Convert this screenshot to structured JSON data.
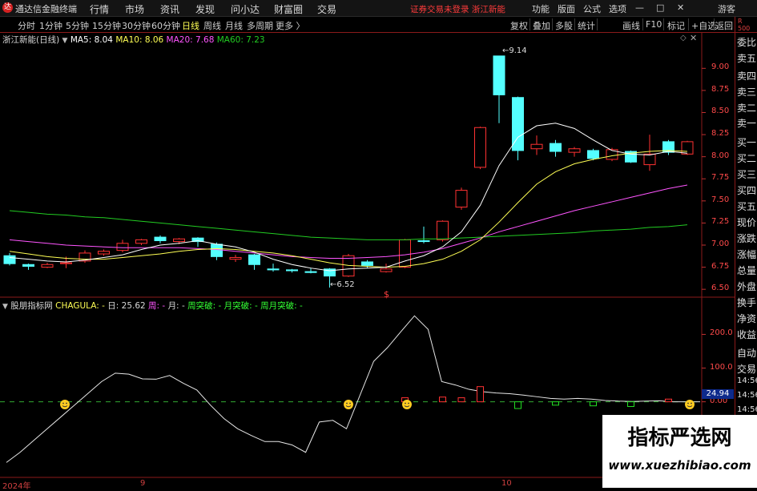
{
  "app": {
    "logo": "达",
    "title": "通达信金融终端"
  },
  "menu": [
    "行情",
    "市场",
    "资讯",
    "发现",
    "问小达",
    "财富圈",
    "交易"
  ],
  "notice": "证券交易未登录  浙江新能",
  "top_right": [
    "功能",
    "版面",
    "公式",
    "选项"
  ],
  "window": {
    "min": "—",
    "max": "□",
    "close": "✕",
    "guest": "游客"
  },
  "periods": [
    {
      "label": "分时",
      "active": false
    },
    {
      "label": "1分钟",
      "active": false
    },
    {
      "label": "5分钟",
      "active": false
    },
    {
      "label": "15分钟",
      "active": false
    },
    {
      "label": "30分钟",
      "active": false
    },
    {
      "label": "60分钟",
      "active": false
    },
    {
      "label": "日线",
      "active": true
    },
    {
      "label": "周线",
      "active": false
    },
    {
      "label": "月线",
      "active": false
    },
    {
      "label": "多周期",
      "active": false
    },
    {
      "label": "更多 〉",
      "active": false
    }
  ],
  "tools": [
    "复权",
    "叠加",
    "多股",
    "统计",
    "画线",
    "F10",
    "标记",
    "+自选",
    "返回"
  ],
  "main_legend": {
    "title": "浙江新能(日线)",
    "ma5": "MA5: 8.04",
    "ma10": "MA10: 8.06",
    "ma20": "MA20: 7.68",
    "ma60": "MA60: 7.23"
  },
  "sub_legend": {
    "title": "股朋指标网",
    "chagula": "CHAGULA: -",
    "day": "日: 25.62",
    "week": "周: -",
    "month": "月: -",
    "weekbreak": "周突破: -",
    "monthbreak": "月突破: -",
    "wmbreak": "周月突破: -"
  },
  "right_panel": {
    "top": "R\n500",
    "items": [
      "委比",
      "卖五",
      "卖四",
      "卖三",
      "卖二",
      "卖一",
      "买一",
      "买二",
      "买三",
      "买四",
      "买五",
      "现价",
      "涨跌",
      "涨幅",
      "总量",
      "外盘",
      "换手",
      "净资",
      "收益",
      "自动",
      "交易",
      "14:56",
      "14:56",
      "14:56",
      "14:56",
      "14:56",
      "14:56",
      "14:56",
      "14:56"
    ]
  },
  "watermark": {
    "line1": "指标严选网",
    "line2": "www.xuezhibiao.com"
  },
  "marks": {
    "high": "9.14",
    "low": "6.52",
    "dollar": "$",
    "current_badge": "24.94"
  },
  "colors": {
    "up": "#ff3232",
    "down": "#54ffff",
    "ma5": "#ffffff",
    "ma10": "#ffff55",
    "ma20": "#ff55ff",
    "ma60": "#22cc22",
    "grid": "#8b1a1a"
  },
  "chart_data": [
    {
      "type": "candlestick",
      "title": "浙江新能(日线)",
      "y_ticks": [
        "9.00",
        "8.75",
        "8.50",
        "8.25",
        "8.00",
        "7.75",
        "7.50",
        "7.25",
        "7.00",
        "6.75",
        "6.50"
      ],
      "ylim": [
        6.42,
        9.32
      ],
      "x_labels": [
        "2024年",
        "9",
        "10"
      ],
      "candles": [
        {
          "o": 6.88,
          "c": 6.79,
          "h": 6.91,
          "l": 6.77
        },
        {
          "o": 6.78,
          "c": 6.76,
          "h": 6.79,
          "l": 6.72
        },
        {
          "o": 6.75,
          "c": 6.78,
          "h": 6.8,
          "l": 6.74
        },
        {
          "o": 6.79,
          "c": 6.8,
          "h": 6.87,
          "l": 6.74
        },
        {
          "o": 6.82,
          "c": 6.91,
          "h": 6.94,
          "l": 6.8
        },
        {
          "o": 6.9,
          "c": 6.93,
          "h": 6.95,
          "l": 6.88
        },
        {
          "o": 6.94,
          "c": 7.02,
          "h": 7.06,
          "l": 6.92
        },
        {
          "o": 7.02,
          "c": 7.06,
          "h": 7.07,
          "l": 7.0
        },
        {
          "o": 7.09,
          "c": 7.05,
          "h": 7.11,
          "l": 7.02
        },
        {
          "o": 7.04,
          "c": 7.07,
          "h": 7.08,
          "l": 7.01
        },
        {
          "o": 7.08,
          "c": 7.04,
          "h": 7.09,
          "l": 6.98
        },
        {
          "o": 7.01,
          "c": 6.87,
          "h": 7.03,
          "l": 6.83
        },
        {
          "o": 6.84,
          "c": 6.86,
          "h": 6.89,
          "l": 6.81
        },
        {
          "o": 6.89,
          "c": 6.78,
          "h": 6.9,
          "l": 6.72
        },
        {
          "o": 6.73,
          "c": 6.72,
          "h": 6.79,
          "l": 6.7
        },
        {
          "o": 6.72,
          "c": 6.71,
          "h": 6.73,
          "l": 6.69
        },
        {
          "o": 6.7,
          "c": 6.69,
          "h": 6.74,
          "l": 6.68
        },
        {
          "o": 6.73,
          "c": 6.65,
          "h": 6.74,
          "l": 6.52
        },
        {
          "o": 6.65,
          "c": 6.88,
          "h": 6.9,
          "l": 6.64
        },
        {
          "o": 6.81,
          "c": 6.77,
          "h": 6.83,
          "l": 6.74
        },
        {
          "o": 6.7,
          "c": 6.73,
          "h": 6.79,
          "l": 6.69
        },
        {
          "o": 6.75,
          "c": 7.06,
          "h": 7.07,
          "l": 6.74
        },
        {
          "o": 7.05,
          "c": 7.04,
          "h": 7.21,
          "l": 7.02
        },
        {
          "o": 7.06,
          "c": 7.27,
          "h": 7.28,
          "l": 7.04
        },
        {
          "o": 7.43,
          "c": 7.62,
          "h": 7.65,
          "l": 7.4
        },
        {
          "o": 7.88,
          "c": 8.33,
          "h": 8.34,
          "l": 7.86
        },
        {
          "o": 9.14,
          "c": 8.7,
          "h": 9.14,
          "l": 8.38
        },
        {
          "o": 8.67,
          "c": 8.07,
          "h": 8.68,
          "l": 7.96
        },
        {
          "o": 8.09,
          "c": 8.14,
          "h": 8.24,
          "l": 8.02
        },
        {
          "o": 8.15,
          "c": 8.06,
          "h": 8.19,
          "l": 8.0
        },
        {
          "o": 8.05,
          "c": 8.09,
          "h": 8.11,
          "l": 8.0
        },
        {
          "o": 8.07,
          "c": 7.98,
          "h": 8.09,
          "l": 7.96
        },
        {
          "o": 7.97,
          "c": 8.08,
          "h": 8.1,
          "l": 7.95
        },
        {
          "o": 8.06,
          "c": 7.94,
          "h": 8.07,
          "l": 7.93
        },
        {
          "o": 7.91,
          "c": 8.03,
          "h": 8.25,
          "l": 7.84
        },
        {
          "o": 8.17,
          "c": 8.05,
          "h": 8.19,
          "l": 8.02
        },
        {
          "o": 8.03,
          "c": 8.17,
          "h": 8.18,
          "l": 8.02
        }
      ],
      "ma5": [
        6.86,
        6.84,
        6.82,
        6.81,
        6.83,
        6.86,
        6.89,
        6.95,
        7.0,
        7.02,
        7.05,
        7.01,
        6.98,
        6.92,
        6.84,
        6.78,
        6.74,
        6.71,
        6.73,
        6.74,
        6.75,
        6.82,
        6.88,
        6.98,
        7.15,
        7.45,
        7.9,
        8.22,
        8.35,
        8.38,
        8.32,
        8.19,
        8.07,
        8.03,
        8.02,
        8.06,
        8.04
      ],
      "ma10": [
        6.93,
        6.9,
        6.87,
        6.85,
        6.84,
        6.84,
        6.86,
        6.88,
        6.9,
        6.93,
        6.95,
        6.96,
        6.95,
        6.93,
        6.91,
        6.88,
        6.84,
        6.8,
        6.77,
        6.76,
        6.75,
        6.76,
        6.79,
        6.84,
        6.93,
        7.06,
        7.26,
        7.48,
        7.69,
        7.83,
        7.92,
        7.97,
        8.01,
        8.04,
        8.06,
        8.07,
        8.06
      ],
      "ma20": [
        7.06,
        7.04,
        7.02,
        7.0,
        6.99,
        6.98,
        6.97,
        6.97,
        6.97,
        6.97,
        6.96,
        6.95,
        6.93,
        6.91,
        6.89,
        6.87,
        6.86,
        6.85,
        6.85,
        6.86,
        6.87,
        6.89,
        6.92,
        6.96,
        7.02,
        7.08,
        7.15,
        7.21,
        7.27,
        7.33,
        7.39,
        7.44,
        7.49,
        7.54,
        7.59,
        7.64,
        7.68
      ],
      "ma60": [
        7.39,
        7.37,
        7.35,
        7.34,
        7.32,
        7.31,
        7.29,
        7.27,
        7.25,
        7.23,
        7.21,
        7.19,
        7.17,
        7.15,
        7.13,
        7.11,
        7.09,
        7.08,
        7.07,
        7.06,
        7.06,
        7.06,
        7.07,
        7.07,
        7.08,
        7.09,
        7.1,
        7.11,
        7.12,
        7.13,
        7.14,
        7.16,
        7.17,
        7.18,
        7.2,
        7.21,
        7.23
      ]
    },
    {
      "type": "line",
      "title": "股朋指标网",
      "y_ticks": [
        "200.0",
        "100.0",
        "0.00"
      ],
      "ylim": [
        -210,
        270
      ],
      "series": [
        {
          "name": "CHAGULA",
          "values": [
            -180,
            -150,
            -115,
            -80,
            -45,
            -10,
            25,
            60,
            85,
            82,
            68,
            67,
            78,
            55,
            35,
            -10,
            -50,
            -80,
            -100,
            -118,
            -118,
            -128,
            -150,
            -60,
            -55,
            -80,
            20,
            120,
            160,
            208,
            255,
            215,
            60,
            50,
            37,
            30,
            26,
            24,
            20,
            15,
            10,
            8,
            10,
            8,
            4,
            2,
            1,
            2,
            3,
            0,
            0,
            0
          ]
        }
      ],
      "bars": [
        {
          "i": 21,
          "v": 12
        },
        {
          "i": 23,
          "v": 14
        },
        {
          "i": 24,
          "v": 12
        },
        {
          "i": 25,
          "v": 45
        },
        {
          "i": 27,
          "v": -20
        },
        {
          "i": 29,
          "v": -10
        },
        {
          "i": 31,
          "v": -12
        },
        {
          "i": 33,
          "v": -14
        },
        {
          "i": 35,
          "v": 8
        }
      ]
    }
  ]
}
